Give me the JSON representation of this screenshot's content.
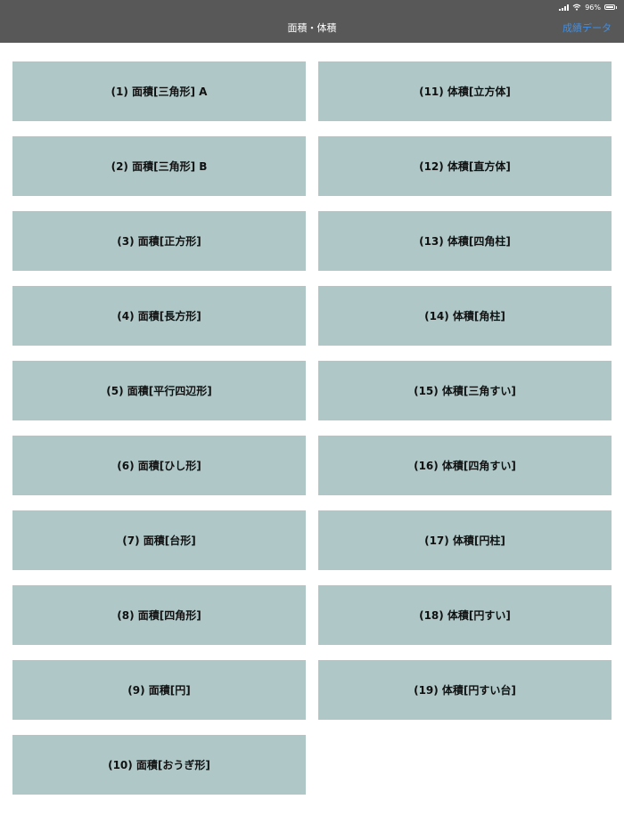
{
  "status": {
    "battery_percent": "96%",
    "battery_level": 0.96,
    "signal_icon": "cellular-signal-icon",
    "wifi_icon": "wifi-icon",
    "battery_icon": "battery-icon"
  },
  "navbar": {
    "title": "面積・体積",
    "action_label": "成績データ",
    "background": "#585858",
    "action_color": "#3d8ee6"
  },
  "tiles_color": "#afc7c7",
  "left_tiles": [
    "(1) 面積[三角形] A",
    "(2) 面積[三角形] B",
    "(3) 面積[正方形]",
    "(4) 面積[長方形]",
    "(5) 面積[平行四辺形]",
    "(6) 面積[ひし形]",
    "(7) 面積[台形]",
    "(8) 面積[四角形]",
    "(9) 面積[円]",
    "(10) 面積[おうぎ形]"
  ],
  "right_tiles": [
    "(11) 体積[立方体]",
    "(12) 体積[直方体]",
    "(13) 体積[四角柱]",
    "(14) 体積[角柱]",
    "(15) 体積[三角すい]",
    "(16) 体積[四角すい]",
    "(17) 体積[円柱]",
    "(18) 体積[円すい]",
    "(19) 体積[円すい台]"
  ]
}
